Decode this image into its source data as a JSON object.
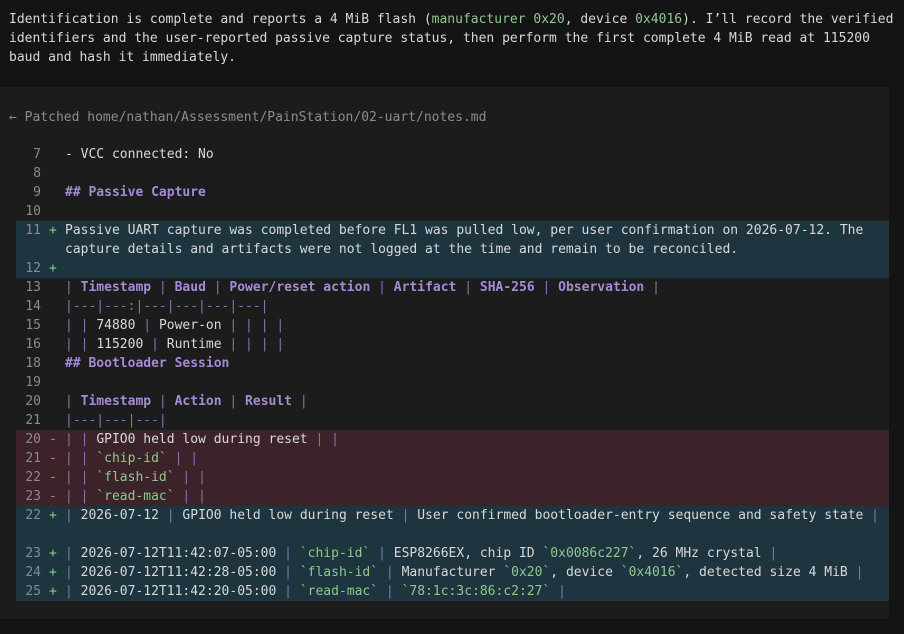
{
  "message": {
    "p1": "Identification is complete and reports a 4 MiB flash (",
    "manufacturer": "manufacturer 0x20",
    "p2": ", device ",
    "device": "0x4016",
    "p3": "). I’ll record the verified identifiers and the user-reported passive capture status, then perform the first complete 4 MiB read at 115200 baud and hash it immediately."
  },
  "patch_header": "← Patched home/nathan/Assessment/PainStation/02-uart/notes.md",
  "lines": [
    {
      "ln": "7",
      "mk": "",
      "kind": "ctx",
      "segs": [
        [
          "t",
          "- VCC connected: No"
        ]
      ]
    },
    {
      "ln": "8",
      "mk": "",
      "kind": "ctx",
      "segs": []
    },
    {
      "ln": "9",
      "mk": "",
      "kind": "ctx",
      "segs": [
        [
          "h",
          "## Passive Capture"
        ]
      ]
    },
    {
      "ln": "10",
      "mk": "",
      "kind": "ctx",
      "segs": []
    },
    {
      "ln": "11",
      "mk": "+",
      "kind": "add",
      "tall": true,
      "segs": [
        [
          "t",
          "Passive UART capture was completed before FL1 was pulled low, per user confirmation on 2026-07-12. The capture details and artifacts were not logged at the time and remain to be reconciled."
        ]
      ]
    },
    {
      "ln": "12",
      "mk": "+",
      "kind": "add",
      "segs": []
    },
    {
      "ln": "13",
      "mk": "",
      "kind": "ctx",
      "segs": [
        [
          "p",
          "| "
        ],
        [
          "h",
          "Timestamp"
        ],
        [
          "p",
          " | "
        ],
        [
          "h",
          "Baud"
        ],
        [
          "p",
          " | "
        ],
        [
          "h",
          "Power/reset action"
        ],
        [
          "p",
          " | "
        ],
        [
          "h",
          "Artifact"
        ],
        [
          "p",
          " | "
        ],
        [
          "h",
          "SHA-256"
        ],
        [
          "p",
          " | "
        ],
        [
          "h",
          "Observation"
        ],
        [
          "p",
          " |"
        ]
      ]
    },
    {
      "ln": "14",
      "mk": "",
      "kind": "ctx",
      "segs": [
        [
          "s",
          "|---|---:|---|---|---|---|"
        ]
      ]
    },
    {
      "ln": "15",
      "mk": "",
      "kind": "ctx",
      "segs": [
        [
          "p",
          "| | "
        ],
        [
          "t",
          "74880"
        ],
        [
          "p",
          " | "
        ],
        [
          "t",
          "Power-on"
        ],
        [
          "p",
          " | | | |"
        ]
      ]
    },
    {
      "ln": "16",
      "mk": "",
      "kind": "ctx",
      "segs": [
        [
          "p",
          "| | "
        ],
        [
          "t",
          "115200"
        ],
        [
          "p",
          " | "
        ],
        [
          "t",
          "Runtime"
        ],
        [
          "p",
          " | | | |"
        ]
      ]
    },
    {
      "ln": "18",
      "mk": "",
      "kind": "ctx",
      "segs": [
        [
          "h",
          "## Bootloader Session"
        ]
      ]
    },
    {
      "ln": "19",
      "mk": "",
      "kind": "ctx",
      "segs": []
    },
    {
      "ln": "20",
      "mk": "",
      "kind": "ctx",
      "segs": [
        [
          "p",
          "| "
        ],
        [
          "h",
          "Timestamp"
        ],
        [
          "p",
          " | "
        ],
        [
          "h",
          "Action"
        ],
        [
          "p",
          " | "
        ],
        [
          "h",
          "Result"
        ],
        [
          "p",
          " |"
        ]
      ]
    },
    {
      "ln": "21",
      "mk": "",
      "kind": "ctx",
      "segs": [
        [
          "s",
          "|---|---|---|"
        ]
      ]
    },
    {
      "ln": "20",
      "mk": "-",
      "kind": "del",
      "segs": [
        [
          "p",
          "| | "
        ],
        [
          "t",
          "GPIO0 held low during reset"
        ],
        [
          "p",
          " | |"
        ]
      ]
    },
    {
      "ln": "21",
      "mk": "-",
      "kind": "del",
      "segs": [
        [
          "p",
          "| | "
        ],
        [
          "c",
          "`chip-id`"
        ],
        [
          "p",
          " | |"
        ]
      ]
    },
    {
      "ln": "22",
      "mk": "-",
      "kind": "del",
      "segs": [
        [
          "p",
          "| | "
        ],
        [
          "c",
          "`flash-id`"
        ],
        [
          "p",
          " | |"
        ]
      ]
    },
    {
      "ln": "23",
      "mk": "-",
      "kind": "del",
      "segs": [
        [
          "p",
          "| | "
        ],
        [
          "c",
          "`read-mac`"
        ],
        [
          "p",
          " | |"
        ]
      ]
    },
    {
      "ln": "22",
      "mk": "+",
      "kind": "add",
      "tall": true,
      "segs": [
        [
          "p",
          "| "
        ],
        [
          "t",
          "2026-07-12"
        ],
        [
          "p",
          " | "
        ],
        [
          "t",
          "GPIO0 held low during reset"
        ],
        [
          "p",
          " | "
        ],
        [
          "t",
          "User confirmed bootloader-entry sequence and safety state"
        ],
        [
          "p",
          " |"
        ]
      ]
    },
    {
      "ln": "23",
      "mk": "+",
      "kind": "add",
      "segs": [
        [
          "p",
          "| "
        ],
        [
          "t",
          "2026-07-12T11:42:07-05:00"
        ],
        [
          "p",
          " | "
        ],
        [
          "c",
          "`chip-id`"
        ],
        [
          "p",
          " | "
        ],
        [
          "t",
          "ESP8266EX, chip ID "
        ],
        [
          "c",
          "`0x0086c227`"
        ],
        [
          "t",
          ", 26 MHz crystal"
        ],
        [
          "p",
          " |"
        ]
      ]
    },
    {
      "ln": "24",
      "mk": "+",
      "kind": "add",
      "segs": [
        [
          "p",
          "| "
        ],
        [
          "t",
          "2026-07-12T11:42:28-05:00"
        ],
        [
          "p",
          " | "
        ],
        [
          "c",
          "`flash-id`"
        ],
        [
          "p",
          " | "
        ],
        [
          "t",
          "Manufacturer "
        ],
        [
          "c",
          "`0x20`"
        ],
        [
          "t",
          ", device "
        ],
        [
          "c",
          "`0x4016`"
        ],
        [
          "t",
          ", detected size 4 MiB"
        ],
        [
          "p",
          " |"
        ]
      ]
    },
    {
      "ln": "25",
      "mk": "+",
      "kind": "add",
      "segs": [
        [
          "p",
          "| "
        ],
        [
          "t",
          "2026-07-12T11:42:20-05:00"
        ],
        [
          "p",
          " | "
        ],
        [
          "c",
          "`read-mac`"
        ],
        [
          "p",
          " | "
        ],
        [
          "c",
          "`78:1c:3c:86:c2:27`"
        ],
        [
          "p",
          " |"
        ]
      ]
    }
  ]
}
